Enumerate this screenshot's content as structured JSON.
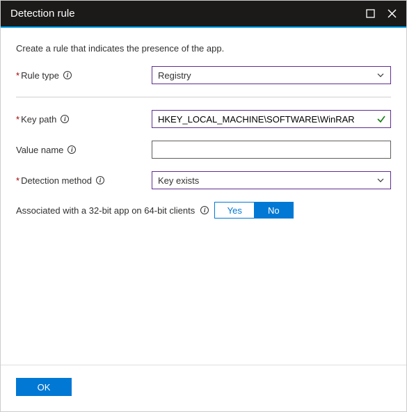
{
  "header": {
    "title": "Detection rule"
  },
  "description": "Create a rule that indicates the presence of the app.",
  "fields": {
    "rule_type": {
      "label": "Rule type",
      "value": "Registry"
    },
    "key_path": {
      "label": "Key path",
      "value": "HKEY_LOCAL_MACHINE\\SOFTWARE\\WinRAR"
    },
    "value_name": {
      "label": "Value name",
      "value": ""
    },
    "detection_method": {
      "label": "Detection method",
      "value": "Key exists"
    },
    "assoc_32bit": {
      "label": "Associated with a 32-bit app on 64-bit clients",
      "yes": "Yes",
      "no": "No",
      "selected": "No"
    }
  },
  "footer": {
    "ok": "OK"
  }
}
